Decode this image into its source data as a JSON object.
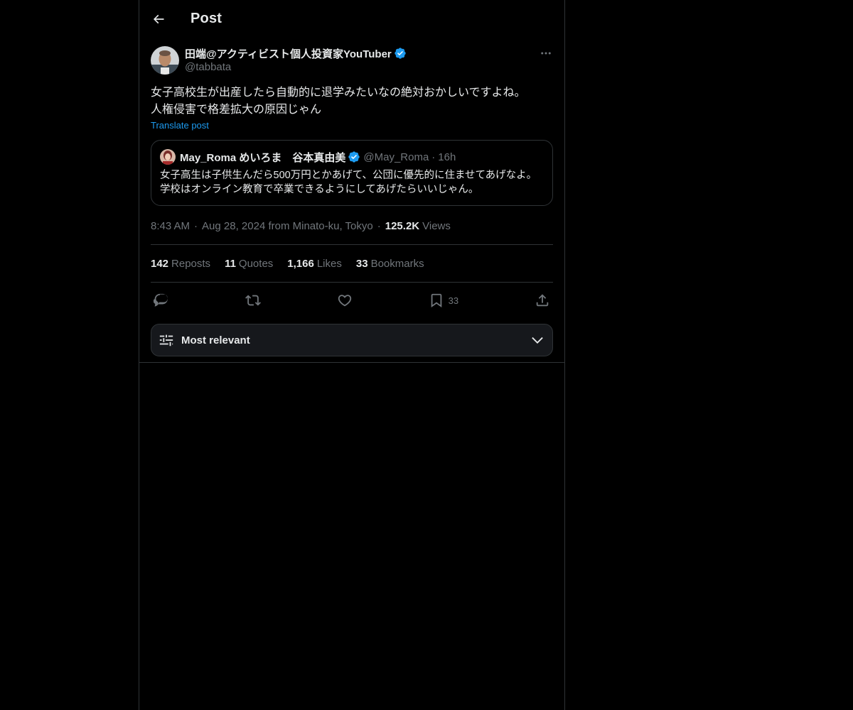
{
  "header": {
    "title": "Post",
    "back_icon": "arrow-left-icon"
  },
  "post": {
    "author_name": "田端@アクティビスト個人投資家YouTuber",
    "author_handle": "@tabbata",
    "verified": true,
    "text": "女子高校生が出産したら自動的に退学みたいなの絶対おかしいですよね。\n人権侵害で格差拡大の原因じゃん",
    "translate_label": "Translate post",
    "time": "8:43 AM",
    "date_location": "Aug 28, 2024 from Minato-ku, Tokyo",
    "views_count": "125.2K",
    "views_label": "Views"
  },
  "quote": {
    "author_name": "May_Roma めいろま　谷本真由美",
    "author_handle": "@May_Roma",
    "time": "16h",
    "text": "女子高生は子供生んだら500万円とかあげて、公団に優先的に住ませてあげなよ。学校はオンライン教育で卒業できるようにしてあげたらいいじゃん。"
  },
  "stats": [
    {
      "num": "142",
      "label": "Reposts"
    },
    {
      "num": "11",
      "label": "Quotes"
    },
    {
      "num": "1,166",
      "label": "Likes"
    },
    {
      "num": "33",
      "label": "Bookmarks"
    }
  ],
  "actions": {
    "bookmark_count": "33"
  },
  "sort": {
    "label": "Most relevant"
  },
  "colors": {
    "background": "#000000",
    "accent": "#1d9bf0",
    "text_primary": "#e7e9ea",
    "text_secondary": "#71767b",
    "border": "#2f3336"
  }
}
